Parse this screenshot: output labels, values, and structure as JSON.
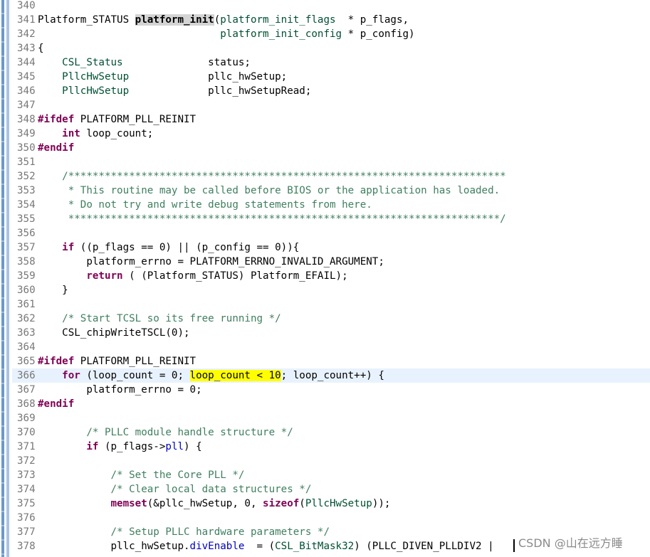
{
  "editor": {
    "lines": [
      {
        "n": "340",
        "parts": []
      },
      {
        "n": "341",
        "parts": [
          {
            "t": "Platform_STATUS ",
            "c": ""
          },
          {
            "t": "platform_init",
            "c": "fn-def"
          },
          {
            "t": "(",
            "c": ""
          },
          {
            "t": "platform_init_flags",
            "c": "ty"
          },
          {
            "t": "  * p_flags,",
            "c": ""
          }
        ]
      },
      {
        "n": "342",
        "parts": [
          {
            "t": "                              ",
            "c": ""
          },
          {
            "t": "platform_init_config",
            "c": "ty"
          },
          {
            "t": " * p_config)",
            "c": ""
          }
        ]
      },
      {
        "n": "343",
        "parts": [
          {
            "t": "{",
            "c": ""
          }
        ]
      },
      {
        "n": "344",
        "parts": [
          {
            "t": "    ",
            "c": ""
          },
          {
            "t": "CSL_Status",
            "c": "ty"
          },
          {
            "t": "              status;",
            "c": ""
          }
        ]
      },
      {
        "n": "345",
        "parts": [
          {
            "t": "    ",
            "c": ""
          },
          {
            "t": "PllcHwSetup",
            "c": "ty"
          },
          {
            "t": "             pllc_hwSetup;",
            "c": ""
          }
        ]
      },
      {
        "n": "346",
        "parts": [
          {
            "t": "    ",
            "c": ""
          },
          {
            "t": "PllcHwSetup",
            "c": "ty"
          },
          {
            "t": "             pllc_hwSetupRead;",
            "c": ""
          }
        ]
      },
      {
        "n": "347",
        "parts": []
      },
      {
        "n": "348",
        "parts": [
          {
            "t": "#ifdef",
            "c": "pp"
          },
          {
            "t": " PLATFORM_PLL_REINIT",
            "c": ""
          }
        ]
      },
      {
        "n": "349",
        "parts": [
          {
            "t": "    ",
            "c": ""
          },
          {
            "t": "int",
            "c": "kw"
          },
          {
            "t": " loop_count;",
            "c": ""
          }
        ]
      },
      {
        "n": "350",
        "parts": [
          {
            "t": "#endif",
            "c": "pp"
          }
        ]
      },
      {
        "n": "351",
        "parts": []
      },
      {
        "n": "352",
        "parts": [
          {
            "t": "    /************************************************************************",
            "c": "cm"
          }
        ]
      },
      {
        "n": "353",
        "parts": [
          {
            "t": "     * This routine may be called before BIOS or the application has loaded.",
            "c": "cm"
          }
        ]
      },
      {
        "n": "354",
        "parts": [
          {
            "t": "     * Do not try and write debug statements from here.",
            "c": "cm"
          }
        ]
      },
      {
        "n": "355",
        "parts": [
          {
            "t": "     ***********************************************************************/",
            "c": "cm"
          }
        ]
      },
      {
        "n": "356",
        "parts": []
      },
      {
        "n": "357",
        "parts": [
          {
            "t": "    ",
            "c": ""
          },
          {
            "t": "if",
            "c": "kw"
          },
          {
            "t": " ((p_flags == 0) || (p_config == 0)){",
            "c": ""
          }
        ]
      },
      {
        "n": "358",
        "parts": [
          {
            "t": "        platform_errno = PLATFORM_ERRNO_INVALID_ARGUMENT;",
            "c": ""
          }
        ]
      },
      {
        "n": "359",
        "parts": [
          {
            "t": "        ",
            "c": ""
          },
          {
            "t": "return",
            "c": "kw"
          },
          {
            "t": " ( (Platform_STATUS) Platform_EFAIL);",
            "c": ""
          }
        ]
      },
      {
        "n": "360",
        "parts": [
          {
            "t": "    }",
            "c": ""
          }
        ]
      },
      {
        "n": "361",
        "parts": []
      },
      {
        "n": "362",
        "parts": [
          {
            "t": "    /* Start TCSL so its free running */",
            "c": "cm"
          }
        ]
      },
      {
        "n": "363",
        "parts": [
          {
            "t": "    CSL_chipWriteTSCL(0);",
            "c": ""
          }
        ]
      },
      {
        "n": "364",
        "parts": []
      },
      {
        "n": "365",
        "parts": [
          {
            "t": "#ifdef",
            "c": "pp"
          },
          {
            "t": " PLATFORM_PLL_REINIT",
            "c": ""
          }
        ]
      },
      {
        "n": "366",
        "current": true,
        "parts": [
          {
            "t": "    ",
            "c": ""
          },
          {
            "t": "for",
            "c": "kw"
          },
          {
            "t": " (loop_count = 0; ",
            "c": ""
          },
          {
            "t": "loop_count < 10",
            "c": "hl"
          },
          {
            "t": "; loop_count++) {",
            "c": ""
          }
        ]
      },
      {
        "n": "367",
        "parts": [
          {
            "t": "        platform_errno = 0;",
            "c": ""
          }
        ]
      },
      {
        "n": "368",
        "parts": [
          {
            "t": "#endif",
            "c": "pp"
          }
        ]
      },
      {
        "n": "369",
        "parts": []
      },
      {
        "n": "370",
        "parts": [
          {
            "t": "        /* PLLC module handle structure */",
            "c": "cm"
          }
        ]
      },
      {
        "n": "371",
        "parts": [
          {
            "t": "        ",
            "c": ""
          },
          {
            "t": "if",
            "c": "kw"
          },
          {
            "t": " (p_flags->",
            "c": ""
          },
          {
            "t": "pll",
            "c": "fld"
          },
          {
            "t": ") {",
            "c": ""
          }
        ]
      },
      {
        "n": "372",
        "parts": []
      },
      {
        "n": "373",
        "parts": [
          {
            "t": "            /* Set the Core PLL */",
            "c": "cm"
          }
        ]
      },
      {
        "n": "374",
        "parts": [
          {
            "t": "            /* Clear local data structures */",
            "c": "cm"
          }
        ]
      },
      {
        "n": "375",
        "parts": [
          {
            "t": "            ",
            "c": ""
          },
          {
            "t": "memset",
            "c": "kw"
          },
          {
            "t": "(&pllc_hwSetup, 0, ",
            "c": ""
          },
          {
            "t": "sizeof",
            "c": "kw"
          },
          {
            "t": "(",
            "c": ""
          },
          {
            "t": "PllcHwSetup",
            "c": "ty"
          },
          {
            "t": "));",
            "c": ""
          }
        ]
      },
      {
        "n": "376",
        "parts": []
      },
      {
        "n": "377",
        "parts": [
          {
            "t": "            /* Setup PLLC hardware parameters */",
            "c": "cm"
          }
        ]
      },
      {
        "n": "378",
        "parts": [
          {
            "t": "            pllc_hwSetup.",
            "c": ""
          },
          {
            "t": "divEnable",
            "c": "fld"
          },
          {
            "t": "  = (",
            "c": ""
          },
          {
            "t": "CSL_BitMask32",
            "c": "ty"
          },
          {
            "t": ") (PLLC_DIVEN_PLLDIV2 |",
            "c": ""
          }
        ]
      }
    ]
  },
  "watermark": "CSDN @山在远方睡"
}
